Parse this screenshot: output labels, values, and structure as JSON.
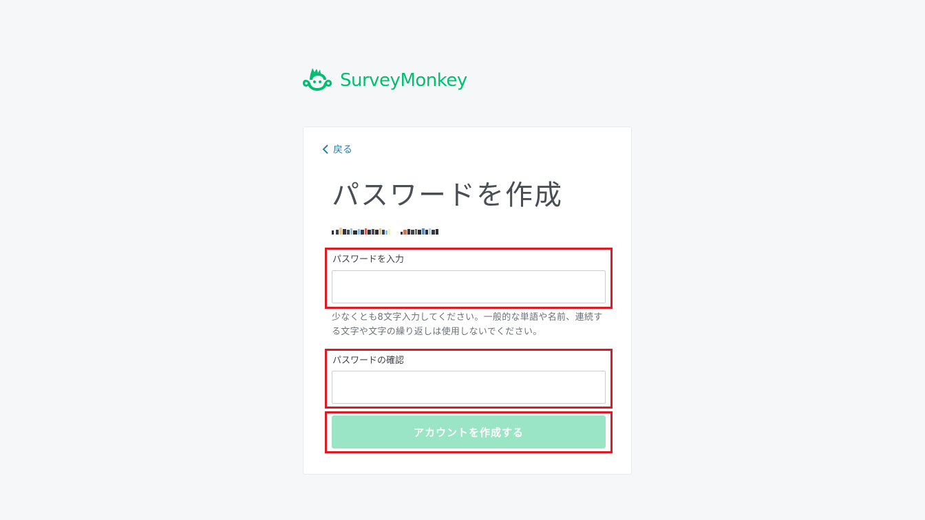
{
  "brand": {
    "name": "SurveyMonkey",
    "color": "#00bf6f",
    "logo_icon": "monkey-logo-icon"
  },
  "nav": {
    "back_label": "戻る",
    "back_icon": "chevron-left-icon"
  },
  "page": {
    "title": "パスワードを作成",
    "email_redacted": true
  },
  "form": {
    "password": {
      "label": "パスワードを入力",
      "value": "",
      "placeholder": ""
    },
    "hint": "少なくとも8文字入力してください。一般的な単語や名前、連続する文字や文字の繰り返しは使用しないでください。",
    "confirm": {
      "label": "パスワードの確認",
      "value": "",
      "placeholder": ""
    },
    "submit_label": "アカウントを作成する"
  },
  "colors": {
    "accent": "#00bf6f",
    "button_disabled": "#99e5c5",
    "link": "#2a7fa8",
    "highlight_border": "#e01a24"
  }
}
